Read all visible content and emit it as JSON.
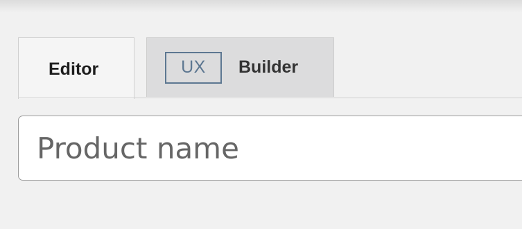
{
  "tabs": [
    {
      "label": "Editor",
      "active": true
    },
    {
      "badge": "UX",
      "label": "Builder",
      "active": false
    }
  ],
  "product_name": {
    "value": "",
    "placeholder": "Product name"
  },
  "colors": {
    "background": "#f1f1f1",
    "active_tab": "#f5f5f5",
    "inactive_tab": "#dcdcdd",
    "ux_badge": "#5d7791",
    "input_border": "#9a9a9a"
  }
}
